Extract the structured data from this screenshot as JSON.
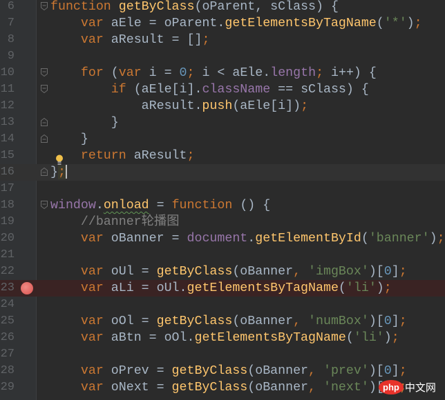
{
  "editor": {
    "current_line": 16,
    "breakpoint_line": 23,
    "fold_lines": [
      6,
      10,
      11,
      13,
      14,
      16,
      18
    ],
    "lines": [
      {
        "n": "6",
        "tokens": [
          [
            "kw",
            "function "
          ],
          [
            "fn",
            "getByClass"
          ],
          [
            "id",
            "(oParent, sClass) {"
          ]
        ]
      },
      {
        "n": "7",
        "tokens": [
          [
            "id",
            "    "
          ],
          [
            "kw",
            "var "
          ],
          [
            "id",
            "aEle = oParent."
          ],
          [
            "fn",
            "getElementsByTagName"
          ],
          [
            "id",
            "("
          ],
          [
            "str",
            "'*'"
          ],
          [
            "id",
            ")"
          ],
          [
            "kw",
            ";"
          ]
        ]
      },
      {
        "n": "8",
        "tokens": [
          [
            "id",
            "    "
          ],
          [
            "kw",
            "var "
          ],
          [
            "id",
            "aResult = []"
          ],
          [
            "kw",
            ";"
          ]
        ]
      },
      {
        "n": "9",
        "tokens": []
      },
      {
        "n": "10",
        "tokens": [
          [
            "id",
            "    "
          ],
          [
            "kw",
            "for "
          ],
          [
            "id",
            "("
          ],
          [
            "kw",
            "var "
          ],
          [
            "id",
            "i = "
          ],
          [
            "num",
            "0"
          ],
          [
            "kw",
            "; "
          ],
          [
            "id",
            "i < aEle."
          ],
          [
            "glob",
            "length"
          ],
          [
            "kw",
            "; "
          ],
          [
            "id",
            "i++) {"
          ]
        ]
      },
      {
        "n": "11",
        "tokens": [
          [
            "id",
            "        "
          ],
          [
            "kw",
            "if "
          ],
          [
            "id",
            "(aEle[i]."
          ],
          [
            "glob",
            "className"
          ],
          [
            "id",
            " == sClass) {"
          ]
        ]
      },
      {
        "n": "12",
        "tokens": [
          [
            "id",
            "            aResult."
          ],
          [
            "fn",
            "push"
          ],
          [
            "id",
            "(aEle[i])"
          ],
          [
            "kw",
            ";"
          ]
        ]
      },
      {
        "n": "13",
        "tokens": [
          [
            "id",
            "        }"
          ]
        ]
      },
      {
        "n": "14",
        "tokens": [
          [
            "id",
            "    }"
          ]
        ]
      },
      {
        "n": "15",
        "tokens": [
          [
            "id",
            "    "
          ],
          [
            "kw",
            "return "
          ],
          [
            "id",
            "aResult"
          ],
          [
            "kw",
            ";"
          ]
        ]
      },
      {
        "n": "16",
        "tokens": [
          [
            "id",
            "}"
          ],
          [
            "semi",
            ";"
          ]
        ]
      },
      {
        "n": "17",
        "tokens": []
      },
      {
        "n": "18",
        "tokens": [
          [
            "glob",
            "window"
          ],
          [
            "id",
            "."
          ],
          [
            "prop",
            "onload"
          ],
          [
            "id",
            " = "
          ],
          [
            "kw",
            "function "
          ],
          [
            "id",
            "() {"
          ]
        ]
      },
      {
        "n": "19",
        "tokens": [
          [
            "id",
            "    "
          ],
          [
            "cm",
            "//banner轮播图"
          ]
        ]
      },
      {
        "n": "20",
        "tokens": [
          [
            "id",
            "    "
          ],
          [
            "kw",
            "var "
          ],
          [
            "id",
            "oBanner = "
          ],
          [
            "glob",
            "document"
          ],
          [
            "id",
            "."
          ],
          [
            "fn",
            "getElementById"
          ],
          [
            "id",
            "("
          ],
          [
            "str",
            "'banner'"
          ],
          [
            "id",
            ")"
          ],
          [
            "kw",
            ";"
          ]
        ]
      },
      {
        "n": "21",
        "tokens": []
      },
      {
        "n": "22",
        "tokens": [
          [
            "id",
            "    "
          ],
          [
            "kw",
            "var "
          ],
          [
            "id",
            "oUl = "
          ],
          [
            "fn",
            "getByClass"
          ],
          [
            "id",
            "(oBanner"
          ],
          [
            "kw",
            ", "
          ],
          [
            "str",
            "'imgBox'"
          ],
          [
            "id",
            ")["
          ],
          [
            "num",
            "0"
          ],
          [
            "id",
            "]"
          ],
          [
            "kw",
            ";"
          ]
        ]
      },
      {
        "n": "23",
        "tokens": [
          [
            "id",
            "    "
          ],
          [
            "kw",
            "var "
          ],
          [
            "id",
            "aLi = oUl."
          ],
          [
            "fn",
            "getElementsByTagName"
          ],
          [
            "id",
            "("
          ],
          [
            "str",
            "'li'"
          ],
          [
            "id",
            ")"
          ],
          [
            "kw",
            ";"
          ]
        ]
      },
      {
        "n": "24",
        "tokens": []
      },
      {
        "n": "25",
        "tokens": [
          [
            "id",
            "    "
          ],
          [
            "kw",
            "var "
          ],
          [
            "id",
            "oOl = "
          ],
          [
            "fn",
            "getByClass"
          ],
          [
            "id",
            "(oBanner"
          ],
          [
            "kw",
            ", "
          ],
          [
            "str",
            "'numBox'"
          ],
          [
            "id",
            ")["
          ],
          [
            "num",
            "0"
          ],
          [
            "id",
            "]"
          ],
          [
            "kw",
            ";"
          ]
        ]
      },
      {
        "n": "26",
        "tokens": [
          [
            "id",
            "    "
          ],
          [
            "kw",
            "var "
          ],
          [
            "id",
            "aBtn = oOl."
          ],
          [
            "fn",
            "getElementsByTagName"
          ],
          [
            "id",
            "("
          ],
          [
            "str",
            "'li'"
          ],
          [
            "id",
            ")"
          ],
          [
            "kw",
            ";"
          ]
        ]
      },
      {
        "n": "27",
        "tokens": []
      },
      {
        "n": "28",
        "tokens": [
          [
            "id",
            "    "
          ],
          [
            "kw",
            "var "
          ],
          [
            "id",
            "oPrev = "
          ],
          [
            "fn",
            "getByClass"
          ],
          [
            "id",
            "(oBanner"
          ],
          [
            "kw",
            ", "
          ],
          [
            "str",
            "'prev'"
          ],
          [
            "id",
            ")["
          ],
          [
            "num",
            "0"
          ],
          [
            "id",
            "]"
          ],
          [
            "kw",
            ";"
          ]
        ]
      },
      {
        "n": "29",
        "tokens": [
          [
            "id",
            "    "
          ],
          [
            "kw",
            "var "
          ],
          [
            "id",
            "oNext = "
          ],
          [
            "fn",
            "getByClass"
          ],
          [
            "id",
            "(oBanner"
          ],
          [
            "kw",
            ", "
          ],
          [
            "str",
            "'next'"
          ],
          [
            "id",
            ")["
          ],
          [
            "num",
            "0"
          ],
          [
            "id",
            "]"
          ],
          [
            "kw",
            ";"
          ]
        ]
      }
    ]
  },
  "watermark": {
    "logo": "php",
    "text": "中文网"
  },
  "colors": {
    "keyword": "#cc7832",
    "function": "#ffc66d",
    "identifier": "#a9b7c6",
    "string": "#6a8759",
    "number": "#6897bb",
    "comment": "#808080",
    "global": "#9876aa",
    "background": "#2b2b2b",
    "gutter": "#313335"
  }
}
